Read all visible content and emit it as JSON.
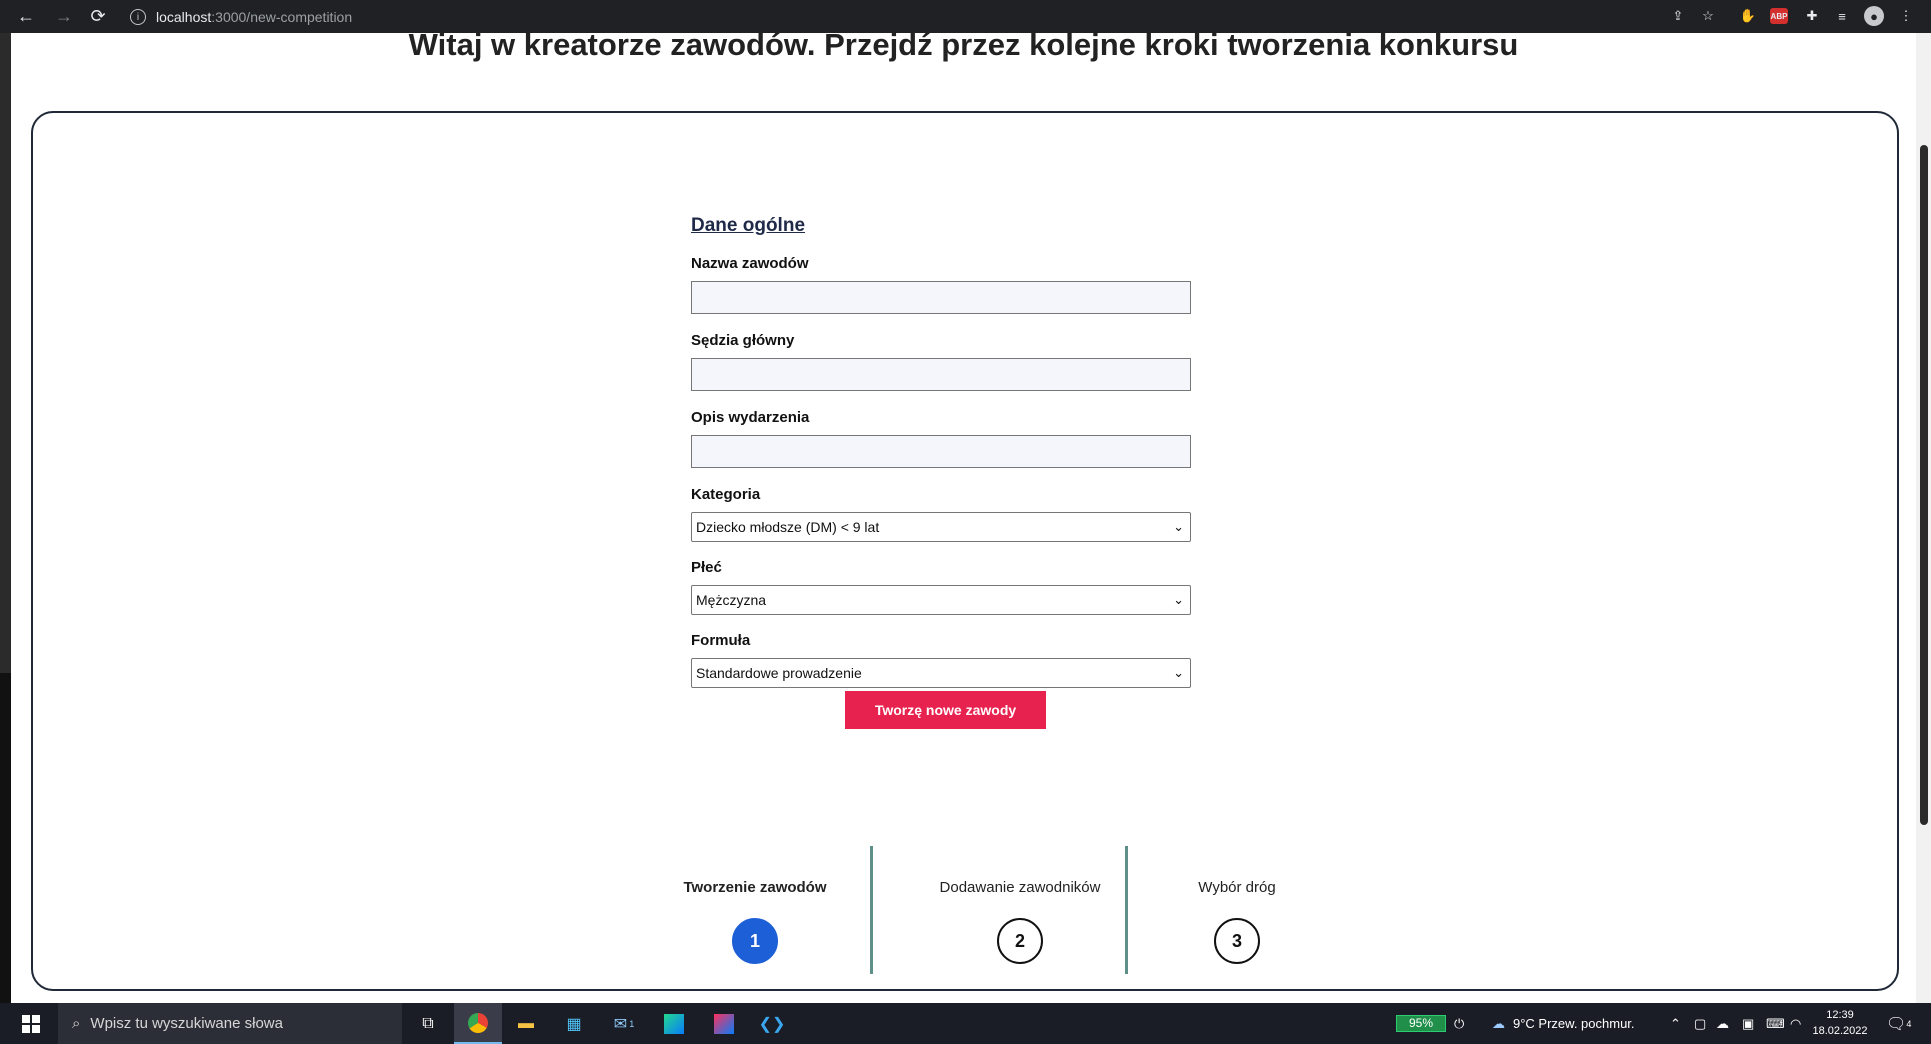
{
  "browser": {
    "url_host": "localhost",
    "url_rest": ":3000/new-competition",
    "extensions": [
      "abp-icon"
    ],
    "abp_label": "ABP"
  },
  "page": {
    "title": "Witaj w kreatorze zawodów. Przejdź przez kolejne kroki tworzenia konkursu"
  },
  "form": {
    "heading": "Dane ogólne",
    "name_label": "Nazwa zawodów",
    "name_value": "",
    "judge_label": "Sędzia główny",
    "judge_value": "",
    "description_label": "Opis wydarzenia",
    "description_value": "",
    "category_label": "Kategoria",
    "category_value": "Dziecko młodsze (DM) < 9 lat",
    "gender_label": "Płeć",
    "gender_value": "Mężczyzna",
    "formula_label": "Formuła",
    "formula_value": "Standardowe prowadzenie",
    "submit_label": "Tworzę nowe zawody"
  },
  "stepper": {
    "steps": [
      {
        "label": "Tworzenie zawodów",
        "number": "1",
        "active": true
      },
      {
        "label": "Dodawanie zawodników",
        "number": "2",
        "active": false
      },
      {
        "label": "Wybór dróg",
        "number": "3",
        "active": false
      }
    ]
  },
  "taskbar": {
    "search_placeholder": "Wpisz tu wyszukiwane słowa",
    "battery": "95%",
    "weather": "9°C  Przew. pochmur.",
    "time": "12:39",
    "date": "18.02.2022",
    "mail_badge": "1",
    "notification_count": "4"
  },
  "colors": {
    "accent_button": "#e8224f",
    "active_step": "#1d5fd6",
    "divider": "#5f8f89"
  }
}
